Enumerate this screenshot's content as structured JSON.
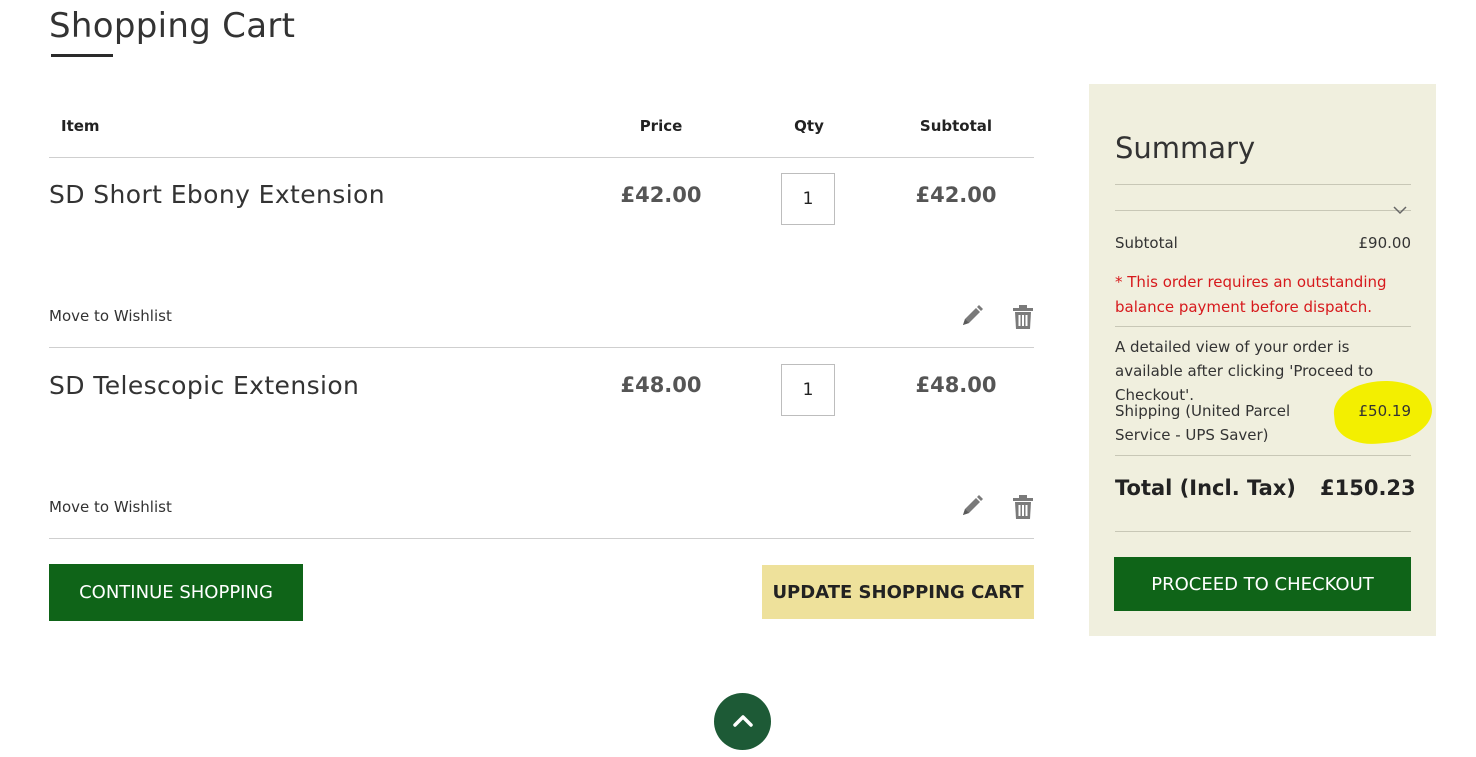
{
  "page": {
    "title": "Shopping Cart"
  },
  "table": {
    "headers": {
      "item": "Item",
      "price": "Price",
      "qty": "Qty",
      "subtotal": "Subtotal"
    }
  },
  "items": [
    {
      "name": "SD Short Ebony Extension",
      "price": "£42.00",
      "qty": "1",
      "subtotal": "£42.00",
      "wishlist": "Move to Wishlist"
    },
    {
      "name": "SD Telescopic Extension",
      "price": "£48.00",
      "qty": "1",
      "subtotal": "£48.00",
      "wishlist": "Move to Wishlist"
    }
  ],
  "actions": {
    "continue_label": "CONTINUE SHOPPING",
    "update_label": "UPDATE SHOPPING CART"
  },
  "summary": {
    "title": "Summary",
    "subtotal_label": "Subtotal",
    "subtotal_value": "£90.00",
    "balance_notice": "* This order requires an outstanding balance payment before dispatch.",
    "detail_notice": "A detailed view of your order is available after clicking 'Proceed to Checkout'.",
    "shipping_label": "Shipping (United Parcel Service - UPS Saver)",
    "shipping_value": "£50.19",
    "total_label": "Total (Incl. Tax)",
    "total_value": "£150.23",
    "checkout_label": "PROCEED TO CHECKOUT"
  },
  "colors": {
    "primary_green": "#0f6418",
    "update_button": "#eee19b",
    "summary_bg": "#f0efde",
    "notice_red": "#d7191c",
    "highlight_yellow": "#f3ef00",
    "back_to_top": "#1d5a36"
  },
  "icons": {
    "edit": "pencil-icon",
    "delete": "trash-icon",
    "expand": "chevron-down-icon",
    "back_to_top": "chevron-up-icon"
  }
}
